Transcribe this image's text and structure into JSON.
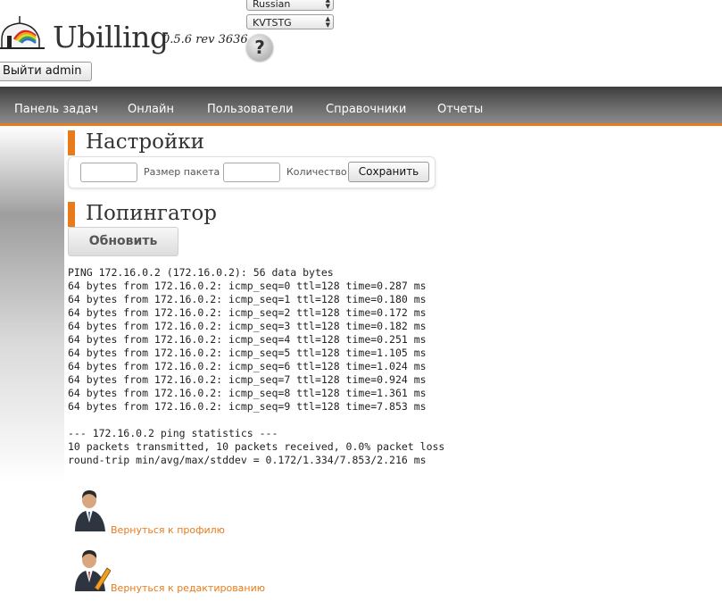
{
  "header": {
    "brand": "Ubilling",
    "version": "0.5.6 rev 3636",
    "language_select": "Russian",
    "db_select": "KVTSTG",
    "help_glyph": "?",
    "logout_label": "Выйти admin"
  },
  "nav": {
    "items": [
      "Панель задач",
      "Онлайн",
      "Пользователи",
      "Справочники",
      "Отчеты"
    ]
  },
  "settings": {
    "title": "Настройки",
    "packet_size_label": "Размер пакета",
    "count_label": "Количество",
    "save_label": "Сохранить"
  },
  "pinger": {
    "title": "Попингатор",
    "refresh_label": "Обновить",
    "output": [
      "PING 172.16.0.2 (172.16.0.2): 56 data bytes",
      "64 bytes from 172.16.0.2: icmp_seq=0 ttl=128 time=0.287 ms",
      "64 bytes from 172.16.0.2: icmp_seq=1 ttl=128 time=0.180 ms",
      "64 bytes from 172.16.0.2: icmp_seq=2 ttl=128 time=0.172 ms",
      "64 bytes from 172.16.0.2: icmp_seq=3 ttl=128 time=0.182 ms",
      "64 bytes from 172.16.0.2: icmp_seq=4 ttl=128 time=0.251 ms",
      "64 bytes from 172.16.0.2: icmp_seq=5 ttl=128 time=1.105 ms",
      "64 bytes from 172.16.0.2: icmp_seq=6 ttl=128 time=1.024 ms",
      "64 bytes from 172.16.0.2: icmp_seq=7 ttl=128 time=0.924 ms",
      "64 bytes from 172.16.0.2: icmp_seq=8 ttl=128 time=1.361 ms",
      "64 bytes from 172.16.0.2: icmp_seq=9 ttl=128 time=7.853 ms",
      "",
      "--- 172.16.0.2 ping statistics ---",
      "10 packets transmitted, 10 packets received, 0.0% packet loss",
      "round-trip min/avg/max/stddev = 0.172/1.334/7.853/2.216 ms"
    ]
  },
  "links": {
    "back_to_profile": "Вернуться к профилю",
    "back_to_edit": "Вернуться к редактированию"
  },
  "colors": {
    "accent": "#e87b1c",
    "nav_dark": "#3d3d3d",
    "nav_light": "#8a8a8a"
  }
}
